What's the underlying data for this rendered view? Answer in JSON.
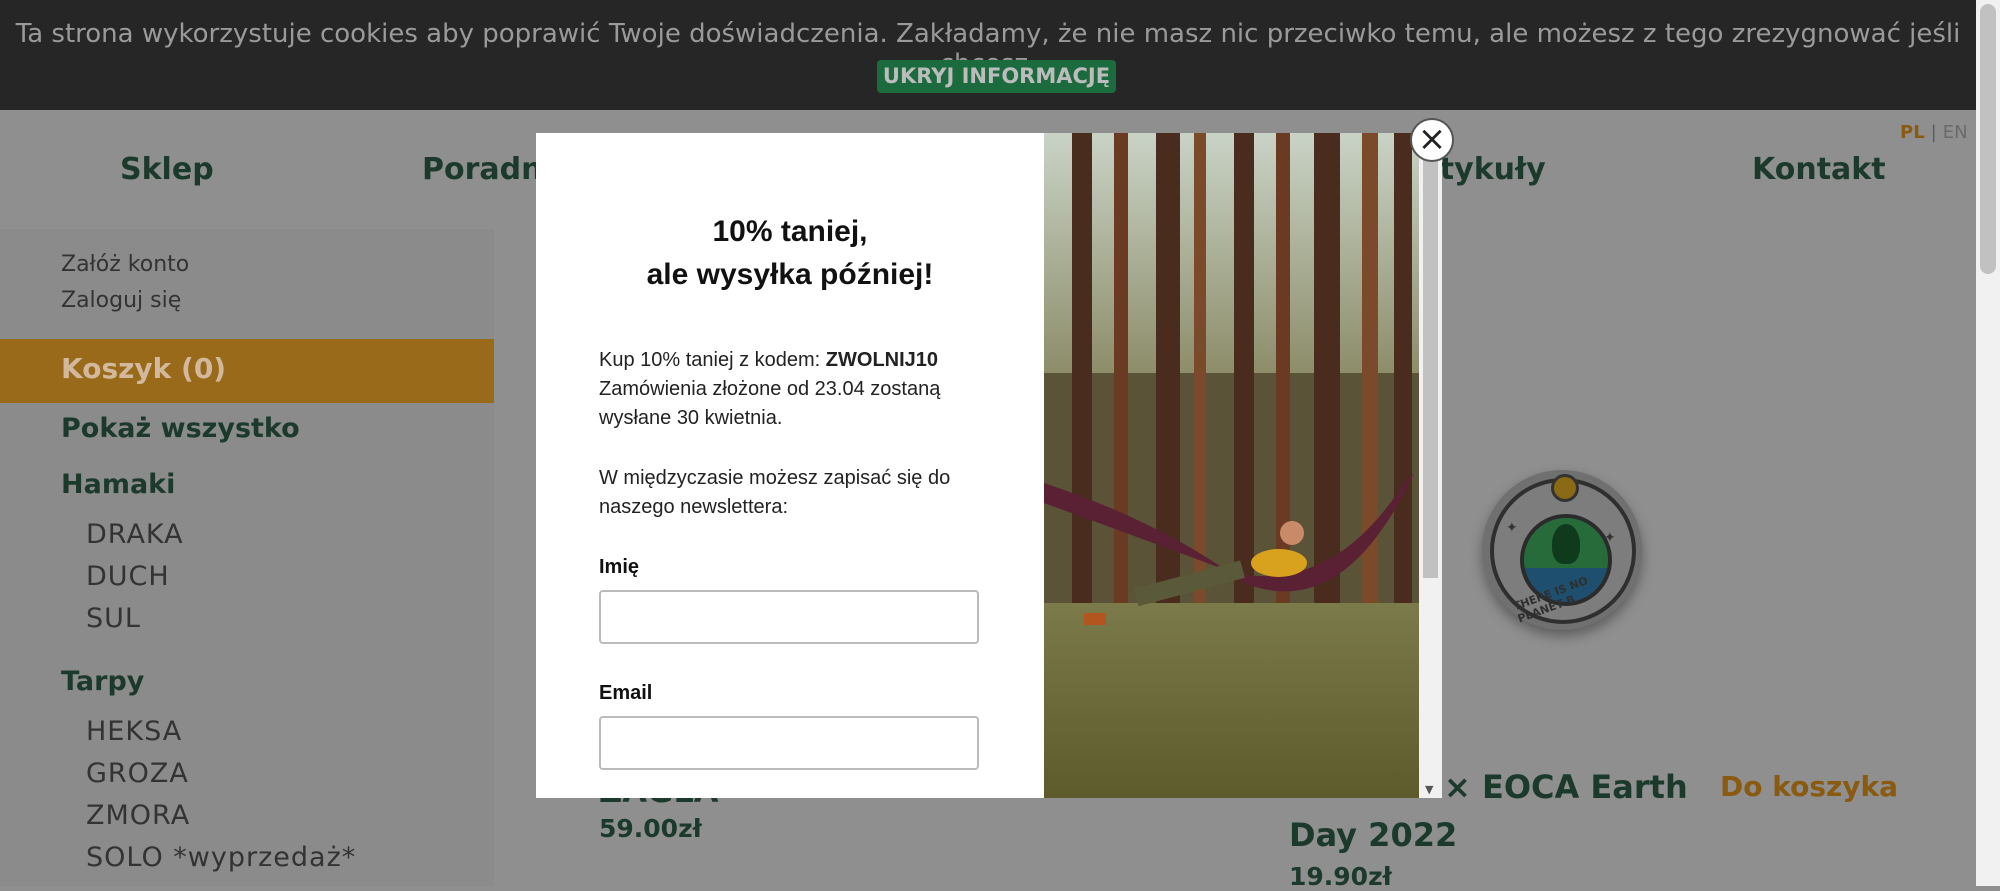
{
  "cookie": {
    "text": "Ta strona wykorzystuje cookies aby poprawić Twoje doświadczenia. Zakładamy, że nie masz nic przeciwko temu, ale możesz z tego zrezygnować jeśli chcesz.",
    "button": "UKRYJ INFORMACJĘ"
  },
  "nav": {
    "items": [
      "Sklep",
      "Poradn",
      "rtykuły",
      "Kontakt"
    ],
    "lang_pl": "PL",
    "lang_sep": "|",
    "lang_en": "EN"
  },
  "sidebar": {
    "register": "Załóż konto",
    "login": "Zaloguj się",
    "cart": "Koszyk (0)",
    "show_all": "Pokaż wszystko",
    "hammocks": "Hamaki",
    "hammock_items": [
      "DRAKA",
      "DUCH",
      "SUL"
    ],
    "tarps": "Tarpy",
    "tarp_items": [
      "HEKSA",
      "GROZA",
      "ZMORA",
      "SOLO *wyprzedaż*"
    ]
  },
  "main": {
    "product1_name_partial": "ZAGŁA",
    "product1_price": "59.00zł",
    "product3_name_line1": "× EOCA Earth",
    "product3_name_line2": "Day 2022",
    "product3_price": "19.90zł",
    "add_to_cart": "Do koszyka",
    "badge_text": "THERE IS NO PLANET B"
  },
  "modal": {
    "title_line1": "10% taniej,",
    "title_line2": "ale wysyłka później!",
    "promo_prefix": "Kup 10% taniej z kodem: ",
    "promo_code": "ZWOLNIJ10",
    "promo_line2": "Zamówienia złożone od 23.04 zostaną",
    "promo_line3": "wysłane 30 kwietnia.",
    "newsletter_line1": "W międzyczasie możesz zapisać się do",
    "newsletter_line2": "naszego newslettera:",
    "name_label": "Imię",
    "email_label": "Email",
    "close": "×"
  },
  "colors": {
    "accent_orange": "#e8a12f",
    "brand_green": "#1b3a2b",
    "cookie_button": "#2ea56a"
  }
}
